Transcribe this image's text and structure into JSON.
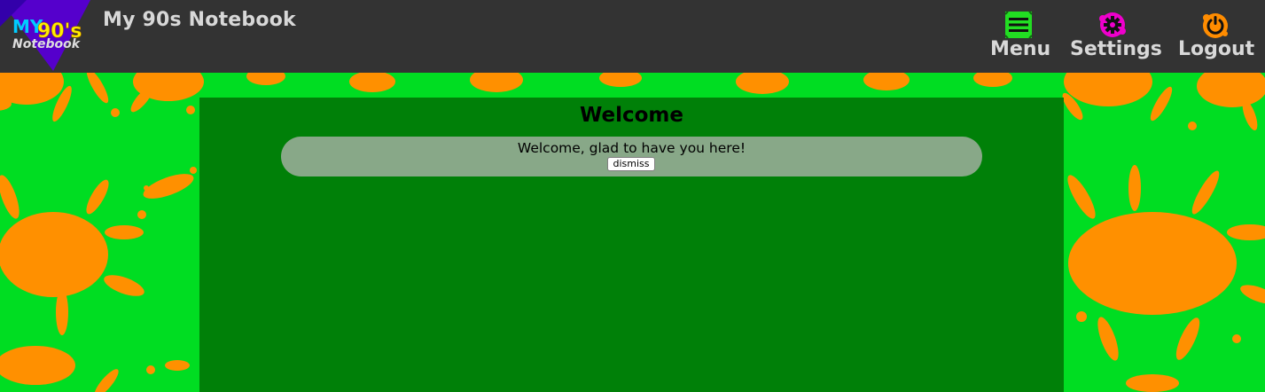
{
  "app": {
    "title": "My 90s Notebook",
    "logo": {
      "line1": "MY",
      "line2": "90's",
      "line3": "Notebook"
    }
  },
  "nav": {
    "items": [
      {
        "label": "Menu",
        "icon": "hamburger-menu-icon",
        "color": "#22dd22"
      },
      {
        "label": "Settings",
        "icon": "gear-icon",
        "color": "#ee00cc"
      },
      {
        "label": "Logout",
        "icon": "power-icon",
        "color": "#ff8c00"
      }
    ]
  },
  "colors": {
    "header_bg": "#333333",
    "page_bg": "#00dd22",
    "splat": "#ff9000",
    "panel_bg": "#008008",
    "notice_bg": "#88a888"
  },
  "main": {
    "title": "Welcome",
    "notice": {
      "message": "Welcome, glad to have you here!",
      "dismiss_label": "dismiss"
    }
  }
}
